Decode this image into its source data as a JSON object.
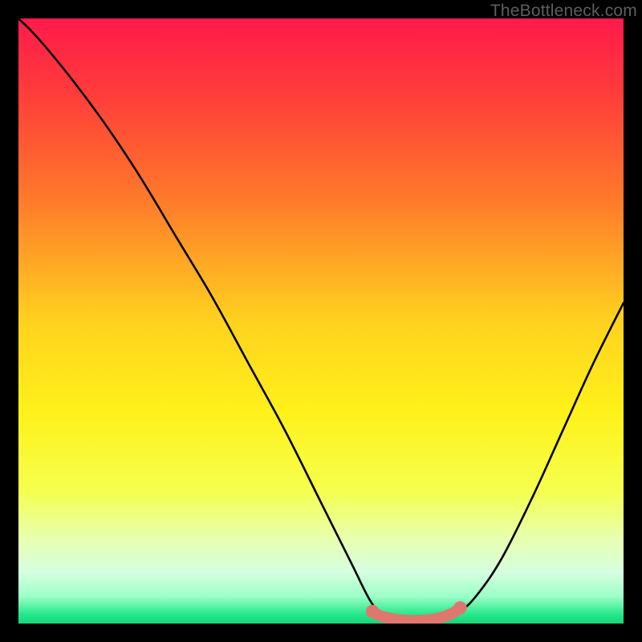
{
  "watermark": "TheBottleneck.com",
  "chart_data": {
    "type": "line",
    "title": "",
    "xlabel": "",
    "ylabel": "",
    "x_range": [
      0,
      100
    ],
    "y_range": [
      0,
      100
    ],
    "note": "V-shaped bottleneck curve over vertical rainbow gradient. Y is percent bottleneck (100=top, 0=bottom). Minimum plateau near x≈62–70.",
    "gradient_stops": [
      {
        "offset": 0.0,
        "color": "#ff1a4b"
      },
      {
        "offset": 0.12,
        "color": "#ff3b3b"
      },
      {
        "offset": 0.3,
        "color": "#ff7a2a"
      },
      {
        "offset": 0.5,
        "color": "#ffd21f"
      },
      {
        "offset": 0.65,
        "color": "#fff11a"
      },
      {
        "offset": 0.78,
        "color": "#f5ff4d"
      },
      {
        "offset": 0.86,
        "color": "#e8ffb0"
      },
      {
        "offset": 0.915,
        "color": "#d6ffe0"
      },
      {
        "offset": 0.955,
        "color": "#9dffc8"
      },
      {
        "offset": 0.985,
        "color": "#25e88a"
      },
      {
        "offset": 1.0,
        "color": "#17d37a"
      }
    ],
    "series": [
      {
        "name": "bottleneck-curve",
        "color": "#000000",
        "points": [
          {
            "x": 0.0,
            "y": 100.0
          },
          {
            "x": 3.0,
            "y": 97.0
          },
          {
            "x": 8.0,
            "y": 91.0
          },
          {
            "x": 14.0,
            "y": 83.0
          },
          {
            "x": 20.0,
            "y": 74.0
          },
          {
            "x": 26.0,
            "y": 64.0
          },
          {
            "x": 32.0,
            "y": 54.0
          },
          {
            "x": 38.0,
            "y": 43.0
          },
          {
            "x": 44.0,
            "y": 32.0
          },
          {
            "x": 50.0,
            "y": 20.0
          },
          {
            "x": 55.0,
            "y": 10.0
          },
          {
            "x": 58.0,
            "y": 4.0
          },
          {
            "x": 60.0,
            "y": 1.5
          },
          {
            "x": 62.0,
            "y": 0.5
          },
          {
            "x": 66.0,
            "y": 0.3
          },
          {
            "x": 70.0,
            "y": 0.8
          },
          {
            "x": 73.0,
            "y": 2.0
          },
          {
            "x": 76.0,
            "y": 5.0
          },
          {
            "x": 80.0,
            "y": 11.0
          },
          {
            "x": 85.0,
            "y": 21.0
          },
          {
            "x": 90.0,
            "y": 32.0
          },
          {
            "x": 95.0,
            "y": 43.0
          },
          {
            "x": 100.0,
            "y": 53.0
          }
        ]
      },
      {
        "name": "optimal-band",
        "color": "#e0776f",
        "stroke_width": 14,
        "note": "Highlighted pink segment near curve minimum with end caps",
        "points": [
          {
            "x": 58.5,
            "y": 2.0
          },
          {
            "x": 60.0,
            "y": 1.2
          },
          {
            "x": 63.0,
            "y": 0.6
          },
          {
            "x": 66.0,
            "y": 0.5
          },
          {
            "x": 69.0,
            "y": 0.8
          },
          {
            "x": 71.5,
            "y": 1.6
          },
          {
            "x": 73.0,
            "y": 2.6
          }
        ],
        "end_caps": [
          {
            "x": 58.5,
            "y": 2.0,
            "r": 1.1
          },
          {
            "x": 73.0,
            "y": 2.6,
            "r": 1.1
          }
        ]
      }
    ]
  }
}
